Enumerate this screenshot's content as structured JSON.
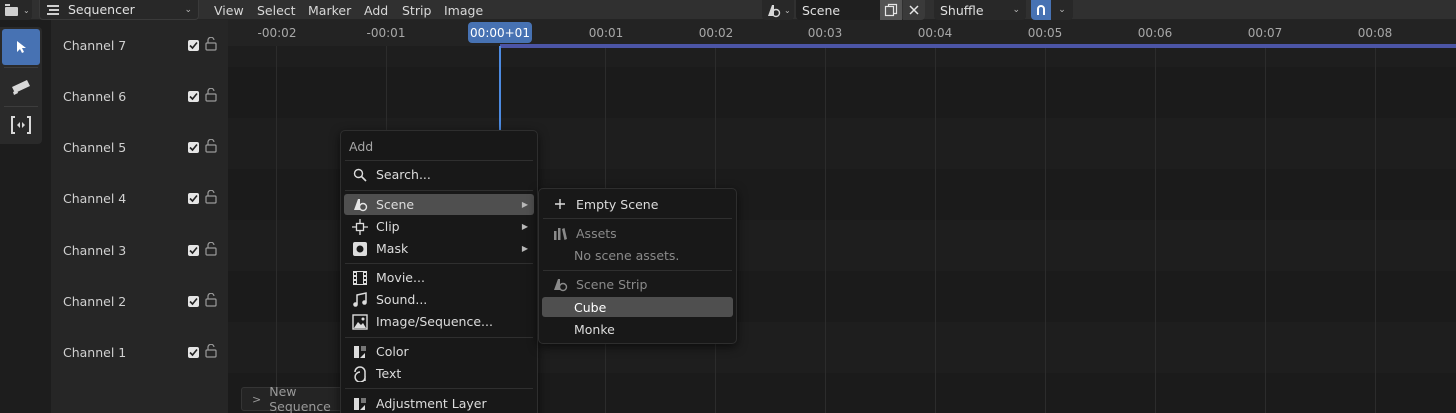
{
  "header": {
    "editor_mode": "Sequencer",
    "menus": [
      "View",
      "Select",
      "Marker",
      "Add",
      "Strip",
      "Image"
    ],
    "scene_name": "Scene",
    "overlap_mode": "Shuffle"
  },
  "channels": [
    "Channel 7",
    "Channel 6",
    "Channel 5",
    "Channel 4",
    "Channel 3",
    "Channel 2",
    "Channel 1"
  ],
  "ruler": {
    "ticks": [
      "-00:02",
      "-00:01",
      "00:01",
      "00:02",
      "00:03",
      "00:04",
      "00:05",
      "00:06",
      "00:07",
      "00:08"
    ],
    "current_frame": "00:00+01"
  },
  "new_sequence_label": "New Sequence",
  "add_menu": {
    "title": "Add",
    "search": "Search...",
    "scene": "Scene",
    "clip": "Clip",
    "mask": "Mask",
    "movie": "Movie...",
    "sound": "Sound...",
    "image_sequence": "Image/Sequence...",
    "color": "Color",
    "text": "Text",
    "adjustment_layer": "Adjustment Layer"
  },
  "scene_submenu": {
    "empty_scene": "Empty Scene",
    "assets_header": "Assets",
    "no_assets": "No scene assets.",
    "scene_strip_header": "Scene Strip",
    "items": [
      "Cube",
      "Monke"
    ]
  },
  "colors": {
    "accent": "#4772b3",
    "range_bar": "#4c55a6",
    "playhead": "#4c8ae0"
  }
}
